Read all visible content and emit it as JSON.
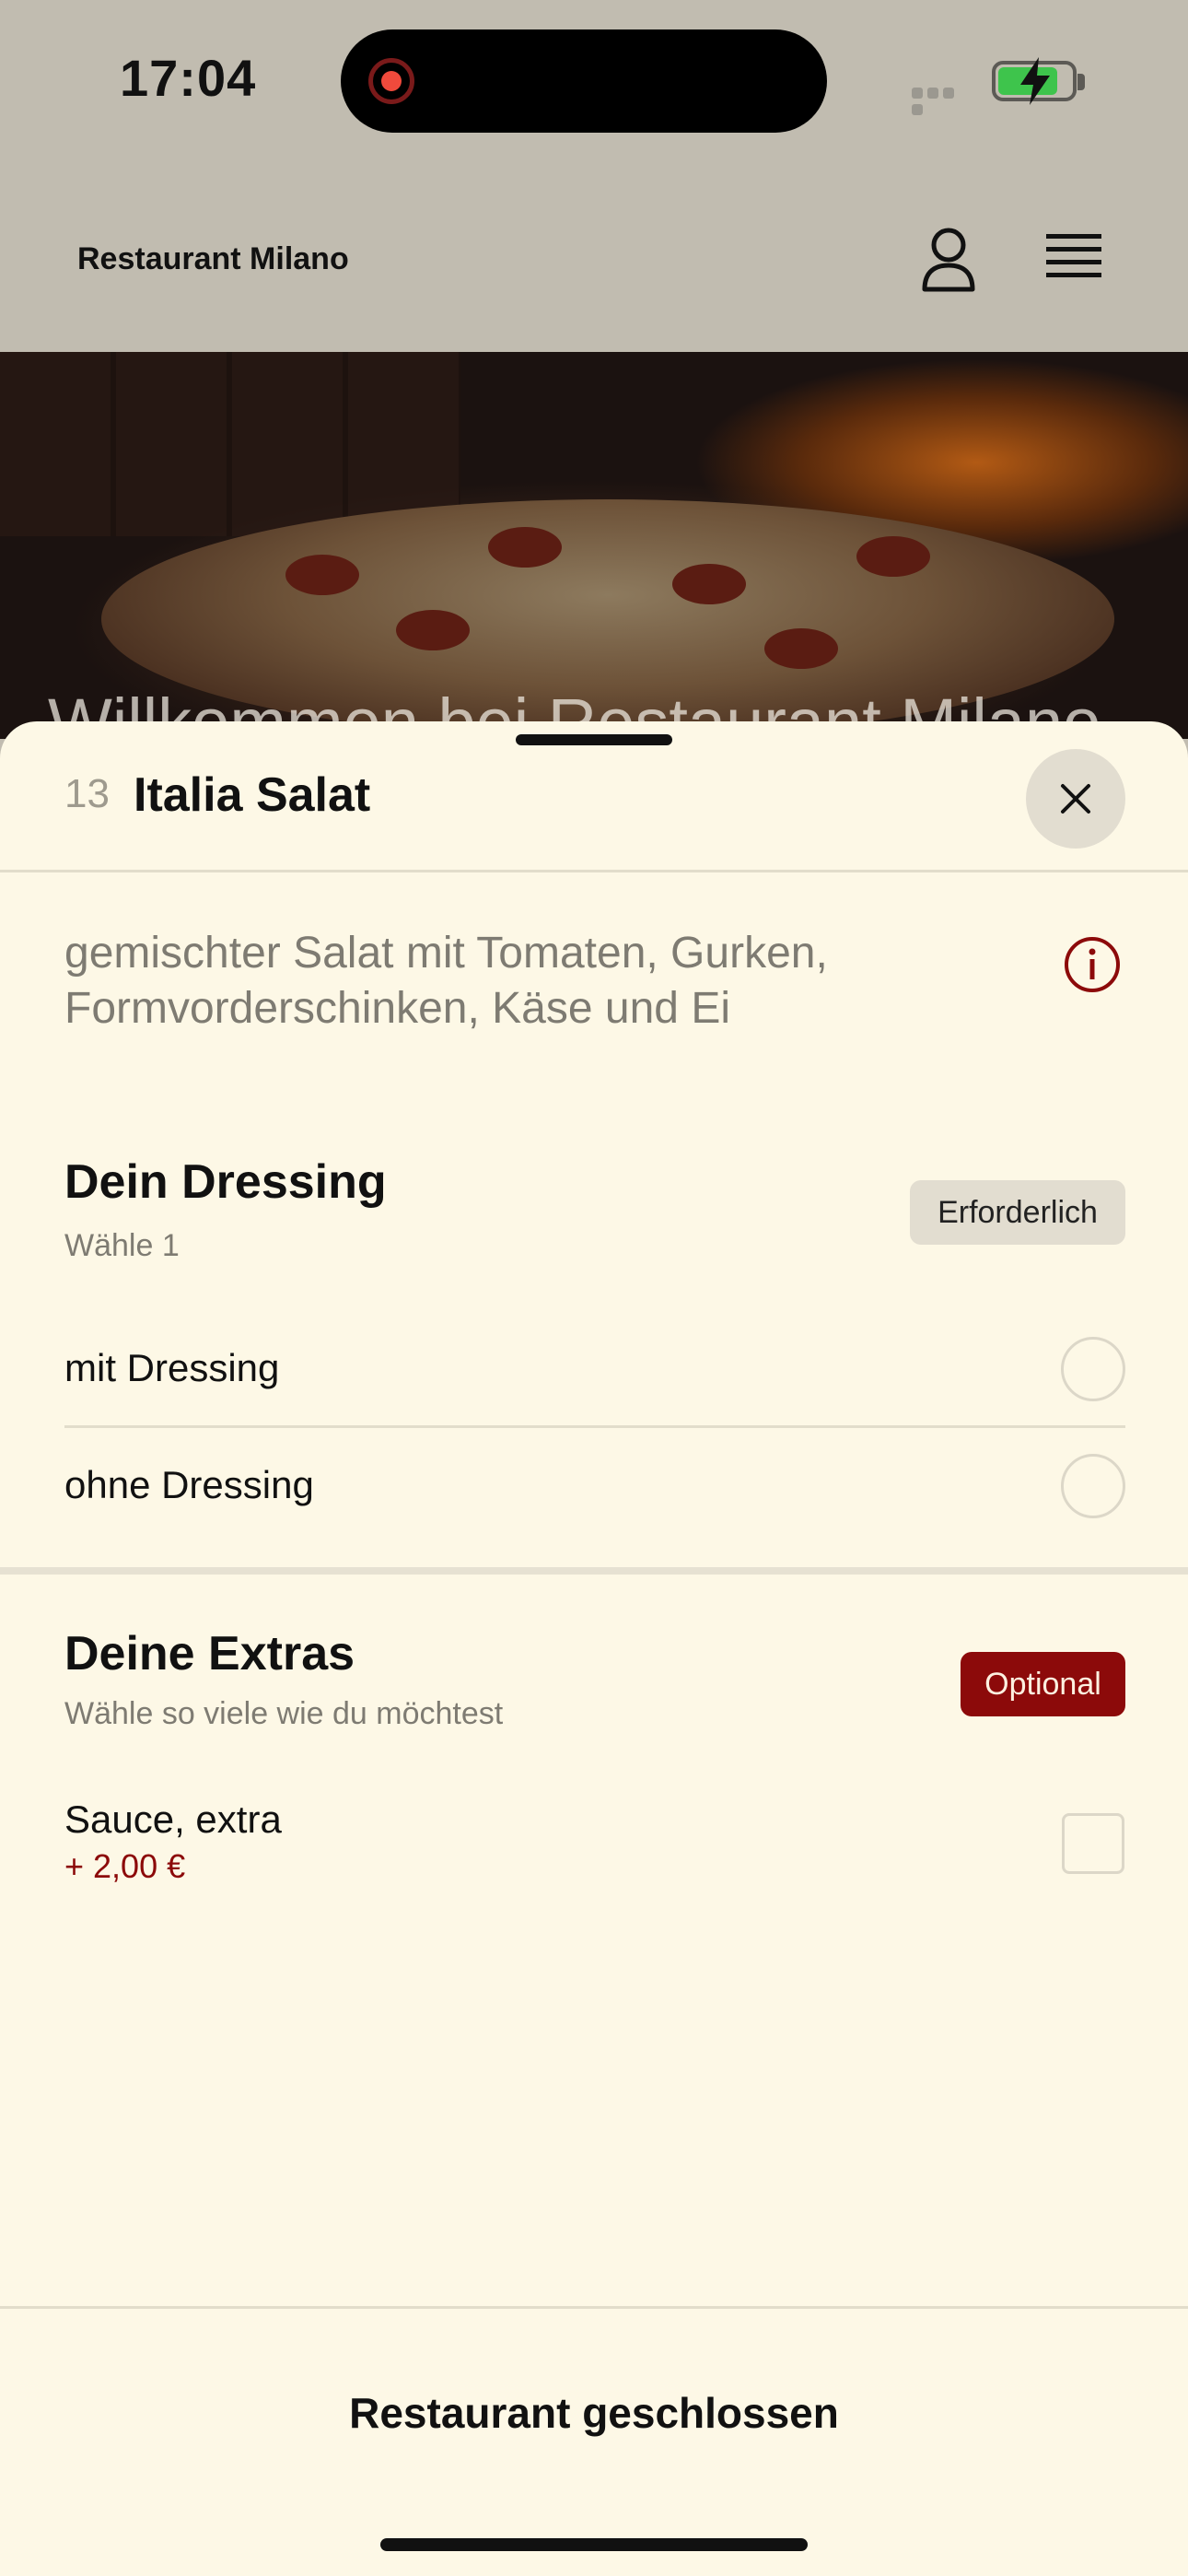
{
  "status": {
    "time": "17:04",
    "recording_icon": "record-icon",
    "signal_icon": "cellular-signal-icon",
    "battery_icon": "battery-charging-icon",
    "battery_color": "#3ec44c"
  },
  "header": {
    "brand": "Restaurant Milano",
    "user_icon": "person-icon",
    "menu_icon": "hamburger-menu-icon"
  },
  "hero": {
    "title": "Willkommen bei Restaurant Milano"
  },
  "sheet": {
    "item_number": "13",
    "item_name": "Italia Salat",
    "close_icon": "close-icon",
    "description": "gemischter Salat mit Tomaten, Gurken, Formvorderschinken, Käse und Ei",
    "info_icon": "info-icon",
    "dressing": {
      "title": "Dein Dressing",
      "subtitle": "Wähle 1",
      "badge": "Erforderlich",
      "options": [
        {
          "label": "mit Dressing"
        },
        {
          "label": "ohne Dressing"
        }
      ]
    },
    "extras": {
      "title": "Deine Extras",
      "subtitle": "Wähle so viele wie du möchtest",
      "badge": "Optional",
      "options": [
        {
          "label": "Sauce, extra",
          "price": "+ 2,00 €"
        }
      ]
    },
    "footer_status": "Restaurant geschlossen"
  },
  "colors": {
    "accent": "#8c0a0a",
    "sheet_background": "#fdf8e6",
    "header_background": "#c1bcb0"
  }
}
